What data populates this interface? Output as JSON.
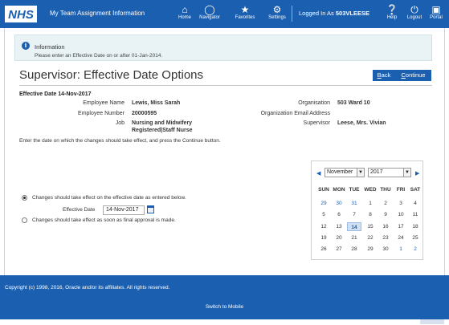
{
  "header": {
    "logo": "NHS",
    "app_title": "My Team Assignment Information",
    "nav": [
      {
        "icon": "home-icon",
        "label": "Home"
      },
      {
        "icon": "navigator-icon",
        "label": "Navigator"
      },
      {
        "icon": "star-icon",
        "label": "Favorites"
      },
      {
        "icon": "gear-icon",
        "label": "Settings"
      }
    ],
    "logged_prefix": "Logged In As",
    "logged_user": "503VLEESE",
    "right_nav": [
      {
        "icon": "help-icon",
        "label": "Help"
      },
      {
        "icon": "power-icon",
        "label": "Logout"
      },
      {
        "icon": "portal-icon",
        "label": "Portal"
      }
    ]
  },
  "info": {
    "title": "Information",
    "message": "Please enter an Effective Date on or after 01-Jan-2014."
  },
  "page": {
    "title": "Supervisor: Effective Date Options",
    "back_label": "Back",
    "back_underline": "B",
    "back_rest": "ack",
    "continue_label": "Continue",
    "continue_underline": "C",
    "continue_rest": "ontinue",
    "effective_date_heading": "Effective Date 14-Nov-2017"
  },
  "details": {
    "employee_name_label": "Employee Name",
    "employee_name": "Lewis, Miss Sarah",
    "employee_number_label": "Employee Number",
    "employee_number": "20000595",
    "job_label": "Job",
    "job_line1": "Nursing and Midwifery",
    "job_line2": "Registered|Staff Nurse",
    "organisation_label": "Organisation",
    "organisation": "503 Ward 10",
    "org_email_label": "Organization Email Address",
    "org_email": "",
    "supervisor_label": "Supervisor",
    "supervisor": "Leese, Mrs. Vivian"
  },
  "instruction": "Enter the date on which the changes should take effect, and press the Continue button.",
  "options": {
    "option1_label": "Changes should take effect on the effective date as entered below.",
    "option1_selected": true,
    "effective_date_label": "Effective Date",
    "effective_date_value": "14-Nov-2017",
    "option2_label": "Changes should take effect as soon as final approval is made.",
    "option2_selected": false
  },
  "calendar": {
    "month": "November",
    "year": "2017",
    "weekdays": [
      "SUN",
      "MON",
      "TUE",
      "WED",
      "THU",
      "FRI",
      "SAT"
    ],
    "weeks": [
      [
        "29",
        "30",
        "31",
        "1",
        "2",
        "3",
        "4"
      ],
      [
        "5",
        "6",
        "7",
        "8",
        "9",
        "10",
        "11"
      ],
      [
        "12",
        "13",
        "14",
        "15",
        "16",
        "17",
        "18"
      ],
      [
        "19",
        "20",
        "21",
        "22",
        "23",
        "24",
        "25"
      ],
      [
        "26",
        "27",
        "28",
        "29",
        "30",
        "1",
        "2"
      ]
    ],
    "selected_day": "14"
  },
  "footer": {
    "copyright": "Copyright (c) 1998, 2016, Oracle and/or its affiliates. All rights reserved.",
    "mobile_link": "Switch to Mobile"
  },
  "colors": {
    "brand_blue": "#1b5fb0",
    "info_bg": "#e9f3f5"
  }
}
